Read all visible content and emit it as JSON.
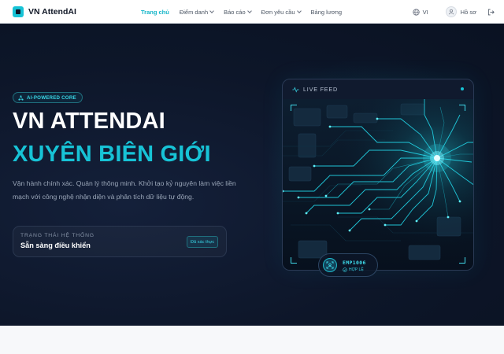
{
  "nav": {
    "brand": "VN AttendAI",
    "items": [
      {
        "label": "Trang chủ",
        "active": true,
        "dropdown": false
      },
      {
        "label": "Điểm danh",
        "active": false,
        "dropdown": true
      },
      {
        "label": "Báo cáo",
        "active": false,
        "dropdown": true
      },
      {
        "label": "Đơn yêu cầu",
        "active": false,
        "dropdown": true
      },
      {
        "label": "Bảng lương",
        "active": false,
        "dropdown": false
      }
    ],
    "language": "VI",
    "profile": "Hồ sơ",
    "icons": {
      "language": "globe-icon",
      "profile": "user-icon",
      "logout": "logout-icon"
    }
  },
  "hero": {
    "badge": "AI-POWERED CORE",
    "title_line1": "VN ATTENDAI",
    "title_line2": "XUYÊN BIÊN GIỚI",
    "description": "Vận hành chính xác. Quản lý thông minh. Khởi tạo kỷ nguyên làm việc liền mạch với công nghệ nhận diện và phân tích dữ liệu tự động.",
    "status": {
      "label": "TRẠNG THÁI HỆ THỐNG",
      "value": "Sẵn sàng điều khiển",
      "verified": "Đã xác thực"
    }
  },
  "feed": {
    "title": "LIVE FEED",
    "employee_id": "EMP1006",
    "employee_status": "HỢP LỆ"
  },
  "colors": {
    "accent": "#17c3d6",
    "hero_bg": "#0d1629",
    "nav_bg": "#ffffff"
  }
}
